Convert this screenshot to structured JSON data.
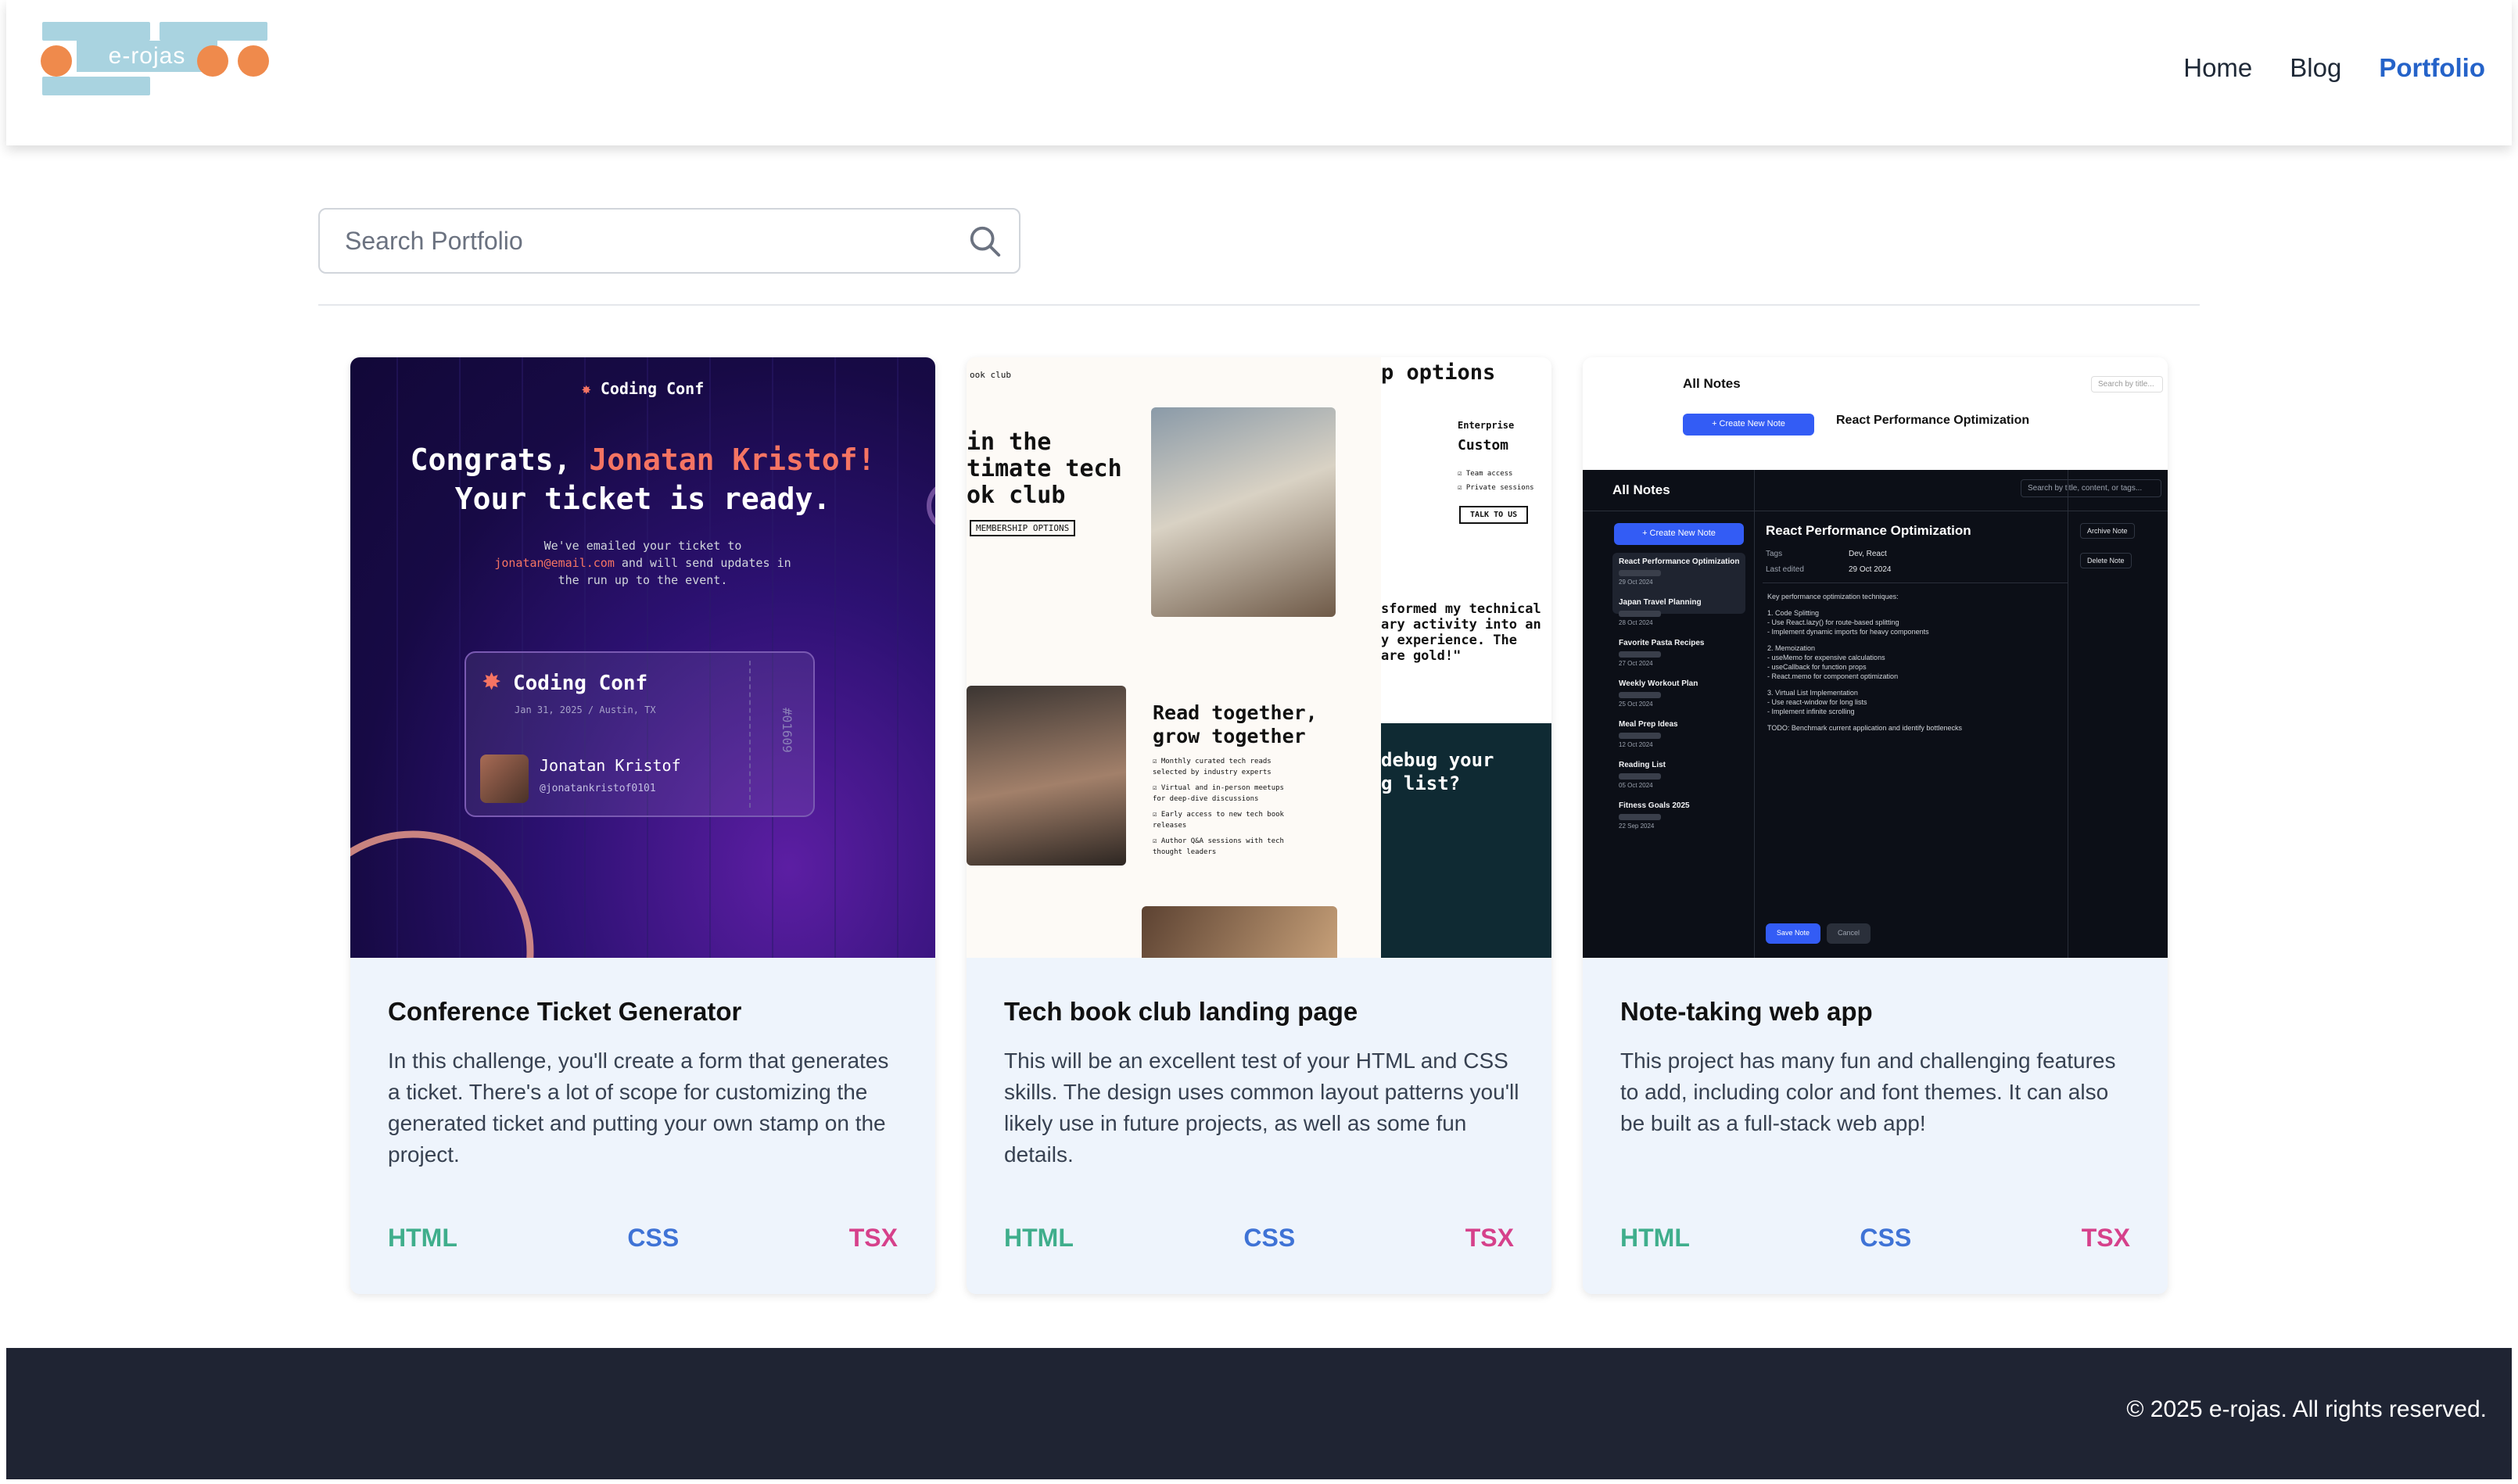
{
  "header": {
    "logo_text": "e-rojas",
    "nav": [
      {
        "label": "Home"
      },
      {
        "label": "Blog"
      },
      {
        "label": "Portfolio",
        "active": true
      }
    ]
  },
  "search": {
    "placeholder": "Search Portfolio",
    "value": ""
  },
  "projects": [
    {
      "title": "Conference Ticket Generator",
      "description": "In this challenge, you'll create a form that generates a ticket. There's a lot of scope for customizing the generated ticket and putting your own stamp on the project.",
      "tags": [
        "HTML",
        "CSS",
        "TSX"
      ],
      "preview": {
        "brand": "Coding Conf",
        "heading_line1_prefix": "Congrats, ",
        "heading_name": "Jonatan Kristof!",
        "heading_line2": "Your ticket is ready.",
        "sub_line1": "We've emailed your ticket to",
        "sub_email": "jonatan@email.com",
        "sub_line2": " and will send updates in",
        "sub_line3": "the run up to the event.",
        "ticket_title": "Coding Conf",
        "ticket_meta": "Jan 31, 2025  /  Austin, TX",
        "ticket_name": "Jonatan Kristof",
        "ticket_handle": "@jonatankristof0101",
        "ticket_number": "#01609"
      }
    },
    {
      "title": "Tech book club landing page",
      "description": "This will be an excellent test of your HTML and CSS skills. The design uses common layout patterns you'll likely use in future projects, as well as some fun details.",
      "tags": [
        "HTML",
        "CSS",
        "TSX"
      ],
      "preview": {
        "small_label": "ook club",
        "hero_1": "in the",
        "hero_2": "timate tech",
        "hero_3": "ok club",
        "options_heading": "p options",
        "enterprise": "Enterprise",
        "custom": "Custom",
        "check_1": "Team access",
        "check_2": "Private sessions",
        "talk_button": "TALK TO US",
        "cta_left": "MEMBERSHIP OPTIONS",
        "quote": "sformed my technical ary activity into an y experience. The are gold!\"",
        "read_together": "Read together, grow together",
        "list_1": "Monthly curated tech reads selected by industry experts",
        "list_2": "Virtual and in-person meetups for deep-dive discussions",
        "list_3": "Early access to new tech book releases",
        "list_4": "Author Q&A sessions with tech thought leaders",
        "debug_1": "debug your",
        "debug_2": "g list?"
      }
    },
    {
      "title": "Note-taking web app",
      "description": "This project has many fun and challenging features to add, including color and font themes. It can also be built as a full-stack web app!",
      "tags": [
        "HTML",
        "CSS",
        "TSX"
      ],
      "preview": {
        "top_title": "All Notes",
        "top_search": "Search by title...",
        "top_note_title": "React Performance Optimization",
        "top_create": "+ Create New Note",
        "dark_title": "All Notes",
        "dark_search": "Search by title, content, or tags...",
        "create_button": "+ Create New Note",
        "note_title": "React Performance Optimization",
        "tags_label": "Tags",
        "tags_value": "Dev, React",
        "edited_label": "Last edited",
        "edited_value": "29 Oct 2024",
        "archive": "Archive Note",
        "delete": "Delete Note",
        "save": "Save Note",
        "cancel": "Cancel",
        "notes": [
          {
            "title": "React Performance Optimization",
            "date": "29 Oct 2024"
          },
          {
            "title": "Japan Travel Planning",
            "date": "28 Oct 2024"
          },
          {
            "title": "Favorite Pasta Recipes",
            "date": "27 Oct 2024"
          },
          {
            "title": "Weekly Workout Plan",
            "date": "25 Oct 2024"
          },
          {
            "title": "Meal Prep Ideas",
            "date": "12 Oct 2024"
          },
          {
            "title": "Reading List",
            "date": "05 Oct 2024"
          },
          {
            "title": "Fitness Goals 2025",
            "date": "22 Sep 2024"
          }
        ],
        "body_lines": [
          "Key performance optimization techniques:",
          "1. Code Splitting",
          "- Use React.lazy() for route-based splitting",
          "- Implement dynamic imports for heavy components",
          "2. Memoization",
          "- useMemo for expensive calculations",
          "- useCallback for function props",
          "- React.memo for component optimization",
          "3. Virtual List Implementation",
          "- Use react-window for long lists",
          "- Implement infinite scrolling",
          "TODO: Benchmark current application and identify bottlenecks"
        ]
      }
    }
  ],
  "footer": {
    "copyright": "© 2025 e-rojas. All rights reserved."
  },
  "colors": {
    "accent": "#2563c9",
    "tag_html": "#3fae8c",
    "tag_css": "#3f73d6",
    "tag_tsx": "#d6418b",
    "footer_bg": "#1f2433",
    "card_bg": "#eef4fc"
  },
  "icons": {
    "search": "search-icon"
  }
}
